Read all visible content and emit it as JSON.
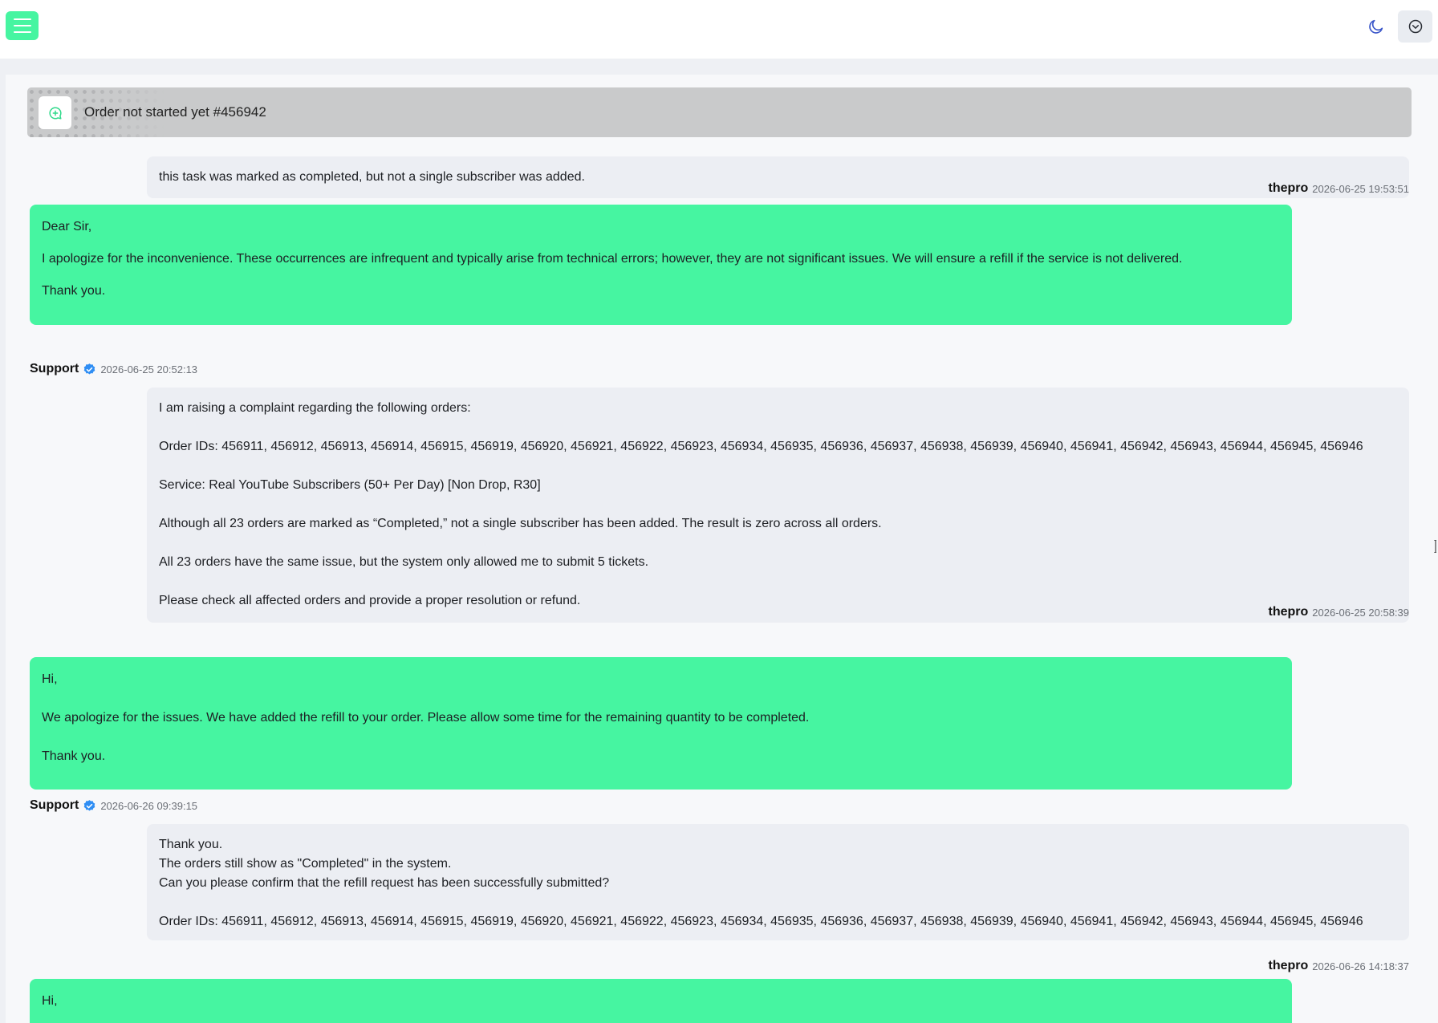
{
  "topbar": {
    "menu_icon": "hamburger-menu-icon",
    "theme_icon": "moon-icon",
    "account_icon": "chevron-down-circle-icon",
    "accent_color": "#46f5a1"
  },
  "ticket": {
    "title": "Order not started yet #456942",
    "icon": "chat-plus-icon"
  },
  "messages": [
    {
      "role": "user",
      "lines": [
        "this task was marked as completed, but not a single subscriber was added."
      ],
      "author": "thepro",
      "time": "2026-06-25 19:53:51"
    },
    {
      "role": "support",
      "lines": [
        "Dear Sir,",
        "",
        "I apologize for the inconvenience. These occurrences are infrequent and typically arise from technical errors; however, they are not significant issues. We will ensure a refill if the service is not delivered.",
        "",
        "Thank you."
      ],
      "author": "Support",
      "time": "2026-06-25 20:52:13"
    },
    {
      "role": "user",
      "lines": [
        "I am raising a complaint regarding the following orders:",
        "",
        "Order IDs: 456911, 456912, 456913, 456914, 456915, 456919, 456920, 456921, 456922, 456923, 456934, 456935, 456936, 456937, 456938, 456939, 456940, 456941, 456942, 456943, 456944, 456945, 456946",
        "",
        "Service: Real YouTube Subscribers (50+ Per Day) [Non Drop, R30]",
        "",
        "Although all 23 orders are marked as “Completed,” not a single subscriber has been added. The result is zero across all orders.",
        "",
        "All 23 orders have the same issue, but the system only allowed me to submit 5 tickets.",
        "",
        "Please check all affected orders and provide a proper resolution or refund."
      ],
      "author": "thepro",
      "time": "2026-06-25 20:58:39"
    },
    {
      "role": "support",
      "lines": [
        "Hi,",
        "",
        "We apologize for the issues. We have added the refill to your order. Please allow some time for the remaining quantity to be completed.",
        "",
        "Thank you."
      ],
      "author": "Support",
      "time": "2026-06-26 09:39:15"
    },
    {
      "role": "user",
      "lines": [
        "Thank you.",
        "The orders still show as \"Completed\" in the system.",
        "Can you please confirm that the refill request has been successfully submitted?",
        "",
        "Order IDs: 456911, 456912, 456913, 456914, 456915, 456919, 456920, 456921, 456922, 456923, 456934, 456935, 456936, 456937, 456938, 456939, 456940, 456941, 456942, 456943, 456944, 456945, 456946"
      ],
      "author": "thepro",
      "time": "2026-06-26 14:18:37"
    },
    {
      "role": "support",
      "lines": [
        "Hi,"
      ]
    }
  ]
}
